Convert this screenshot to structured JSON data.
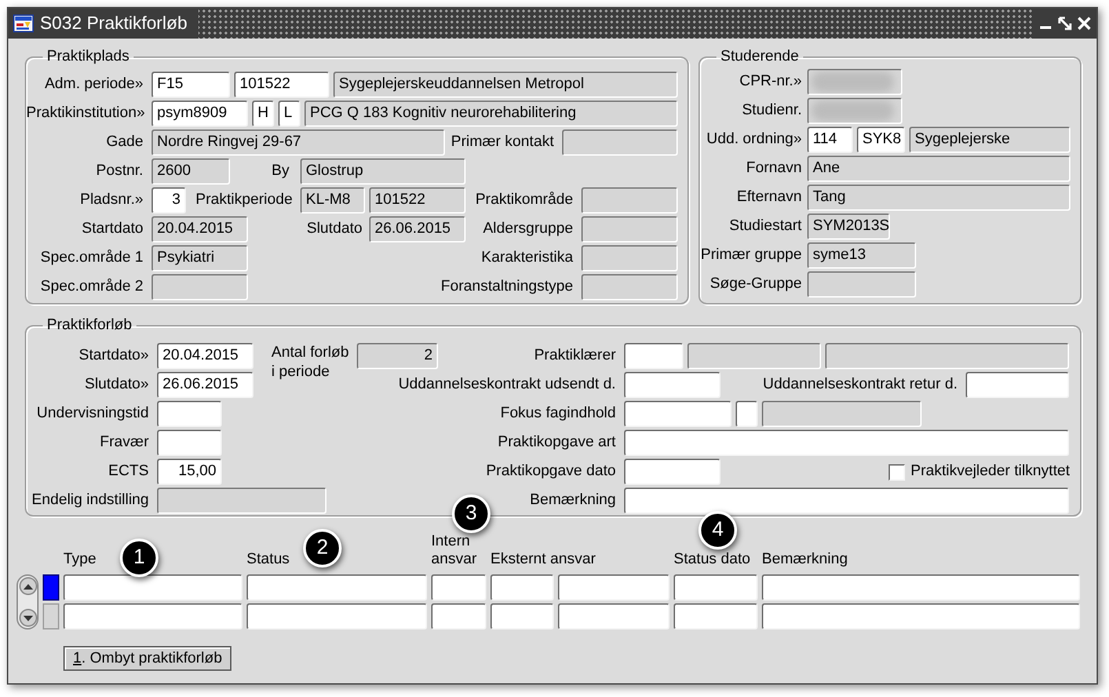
{
  "window": {
    "title": "S032 Praktikforløb"
  },
  "praktikplads": {
    "title": "Praktikplads",
    "adm_periode": {
      "label": "Adm. periode»",
      "fields": [
        {
          "value": "F15",
          "editable": true
        },
        {
          "value": "101522",
          "editable": true
        },
        {
          "value": "Sygeplejerskeuddannelsen Metropol",
          "editable": false
        }
      ]
    },
    "praktikinstitution": {
      "label": "Praktikinstitution»",
      "fields": [
        {
          "value": "psym8909",
          "editable": true
        },
        {
          "value": "H",
          "editable": true
        },
        {
          "value": "L",
          "editable": true
        },
        {
          "value": "PCG Q 183 Kognitiv neurorehabilitering",
          "editable": false
        }
      ]
    },
    "gade": {
      "label": "Gade",
      "fields": [
        {
          "value": "Nordre Ringvej 29-67",
          "editable": false
        }
      ]
    },
    "primaer_kontakt": {
      "label": "Primær kontakt",
      "fields": [
        {
          "editable": false
        }
      ]
    },
    "postnr": {
      "label": "Postnr.",
      "fields": [
        {
          "value": "2600",
          "editable": false
        }
      ]
    },
    "by": {
      "label": "By",
      "fields": [
        {
          "value": "Glostrup",
          "editable": false
        }
      ]
    },
    "pladsnr": {
      "label": "Pladsnr.»",
      "fields": [
        {
          "value": "3",
          "editable": true
        }
      ]
    },
    "praktikperiode": {
      "label": "Praktikperiode",
      "fields": [
        {
          "value": "KL-M8",
          "editable": false
        },
        {
          "value": "101522",
          "editable": false
        }
      ]
    },
    "praktikomraade": {
      "label": "Praktikområde",
      "fields": [
        {
          "editable": false
        }
      ]
    },
    "startdato": {
      "label": "Startdato",
      "fields": [
        {
          "value": "20.04.2015",
          "editable": false
        }
      ]
    },
    "slutdato": {
      "label": "Slutdato",
      "fields": [
        {
          "value": "26.06.2015",
          "editable": false
        }
      ]
    },
    "aldersgruppe": {
      "label": "Aldersgruppe",
      "fields": [
        {
          "editable": false
        }
      ]
    },
    "spec_omraade_1": {
      "label": "Spec.område 1",
      "fields": [
        {
          "value": "Psykiatri",
          "editable": false
        }
      ]
    },
    "karakteristika": {
      "label": "Karakteristika",
      "fields": [
        {
          "editable": false
        }
      ]
    },
    "spec_omraade_2": {
      "label": "Spec.område 2",
      "fields": [
        {
          "editable": false
        }
      ]
    },
    "foranstaltningstype": {
      "label": "Foranstaltningstype",
      "fields": [
        {
          "editable": false
        }
      ]
    }
  },
  "studerende": {
    "title": "Studerende",
    "cpr_nr": {
      "label": "CPR-nr.»",
      "fields": [
        {
          "editable": false,
          "redacted": true
        }
      ]
    },
    "studienr": {
      "label": "Studienr.",
      "fields": [
        {
          "editable": false,
          "redacted": true
        }
      ]
    },
    "udd_ordning": {
      "label": "Udd. ordning»",
      "fields": [
        {
          "value": "114",
          "editable": true
        },
        {
          "value": "SYK8",
          "editable": true
        },
        {
          "value": "Sygeplejerske",
          "editable": false
        }
      ]
    },
    "fornavn": {
      "label": "Fornavn",
      "fields": [
        {
          "value": "Ane",
          "editable": false
        }
      ]
    },
    "efternavn": {
      "label": "Efternavn",
      "fields": [
        {
          "value": "Tang",
          "editable": false
        }
      ]
    },
    "studiestart": {
      "label": "Studiestart",
      "fields": [
        {
          "value": "SYM2013S",
          "editable": false
        }
      ]
    },
    "primaer_gruppe": {
      "label": "Primær gruppe",
      "fields": [
        {
          "value": "syme13",
          "editable": false
        }
      ]
    },
    "soege_gruppe": {
      "label": "Søge-Gruppe",
      "fields": [
        {
          "editable": false
        }
      ]
    }
  },
  "praktikforloeb": {
    "title": "Praktikforløb",
    "startdato": {
      "label": "Startdato»",
      "fields": [
        {
          "value": "20.04.2015",
          "editable": true
        }
      ]
    },
    "antal_forloeb": {
      "label": "Antal forløb i periode",
      "fields": [
        {
          "value": "2",
          "editable": false
        }
      ]
    },
    "praktiklaerer": {
      "label": "Praktiklærer",
      "fields": [
        {
          "editable": true
        },
        {
          "editable": false
        },
        {
          "editable": false
        }
      ]
    },
    "slutdato": {
      "label": "Slutdato»",
      "fields": [
        {
          "value": "26.06.2015",
          "editable": true
        }
      ]
    },
    "kontrakt_udsendt": {
      "label": "Uddannelseskontrakt udsendt d.",
      "fields": [
        {
          "editable": true
        }
      ]
    },
    "kontrakt_retur": {
      "label": "Uddannelseskontrakt retur d.",
      "fields": [
        {
          "editable": true
        }
      ]
    },
    "undervisningstid": {
      "label": "Undervisningstid",
      "fields": [
        {
          "editable": true
        }
      ]
    },
    "fokus_fagindhold": {
      "label": "Fokus fagindhold",
      "fields": [
        {
          "editable": true
        },
        {
          "editable": true
        },
        {
          "editable": false
        }
      ]
    },
    "fravaer": {
      "label": "Fravær",
      "fields": [
        {
          "editable": true
        }
      ]
    },
    "praktikopgave_art": {
      "label": "Praktikopgave art",
      "fields": [
        {
          "editable": true
        }
      ]
    },
    "ects": {
      "label": "ECTS",
      "fields": [
        {
          "value": "15,00",
          "editable": true
        }
      ]
    },
    "praktikopgave_dato": {
      "label": "Praktikopgave dato",
      "fields": [
        {
          "editable": true
        }
      ]
    },
    "praktikvejleder": {
      "label": "Praktikvejleder tilknyttet",
      "checked": false
    },
    "endelig_indstilling": {
      "label": "Endelig indstilling",
      "fields": [
        {
          "editable": false
        }
      ]
    },
    "bemaerkning": {
      "label": "Bemærkning",
      "fields": [
        {
          "editable": true
        }
      ]
    }
  },
  "detail": {
    "columns": [
      "Type",
      "Status",
      "Intern ansvar",
      "Eksternt ansvar",
      "Status dato",
      "Bemærkning"
    ],
    "rows": [
      {
        "selected": true
      },
      {
        "selected": false
      }
    ]
  },
  "button": {
    "label": "1. Ombyt praktikforløb"
  },
  "callouts": [
    "1",
    "2",
    "3",
    "4"
  ]
}
